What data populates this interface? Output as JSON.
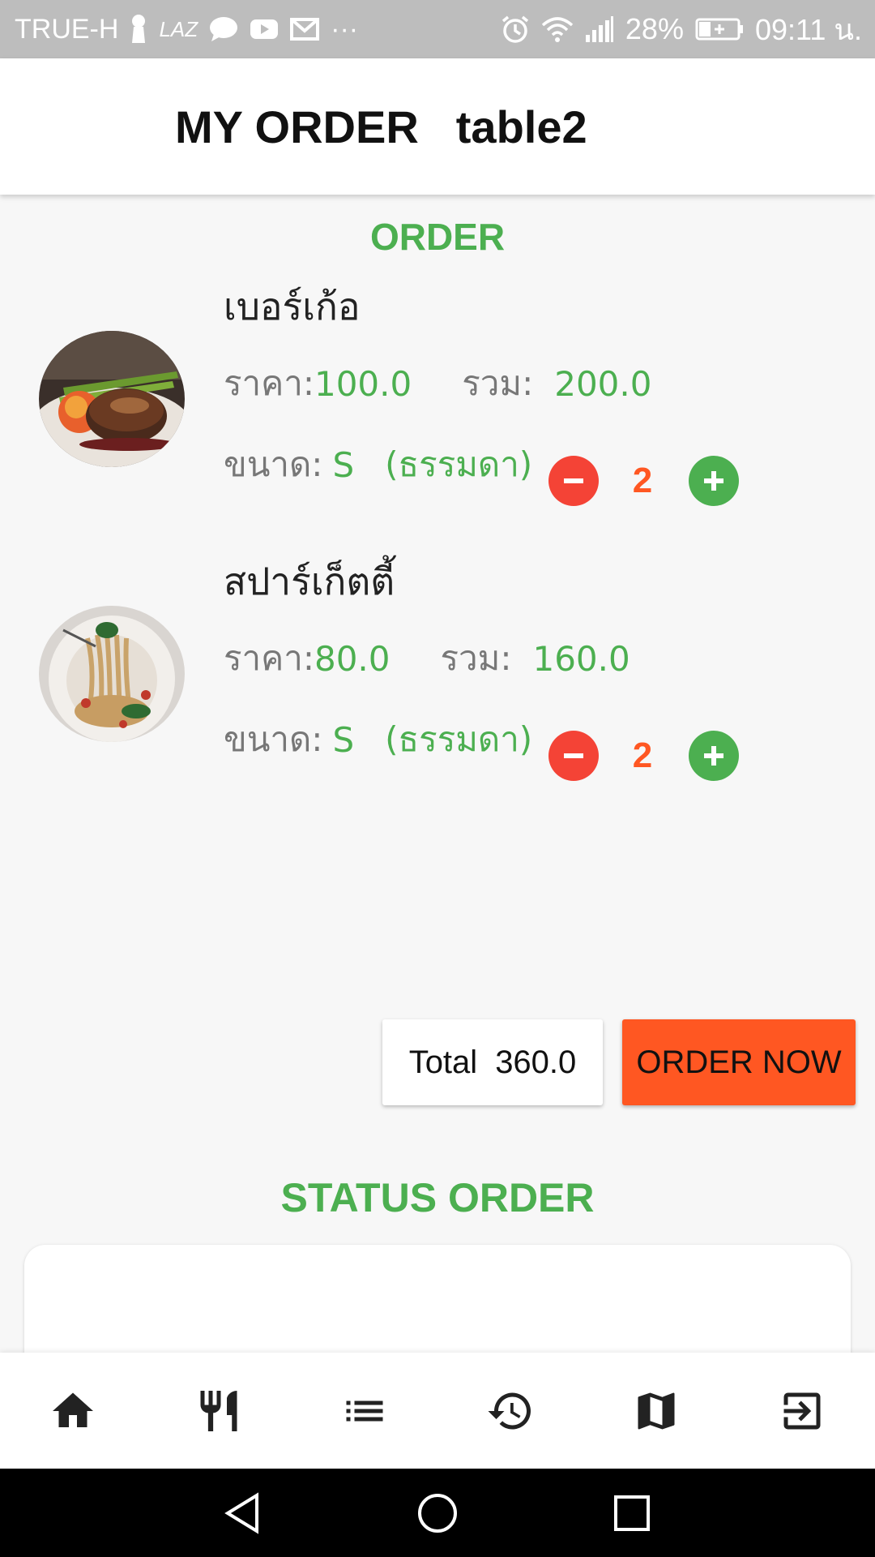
{
  "status_bar": {
    "carrier": "TRUE-H",
    "lazada": "LAZ",
    "more": "···",
    "battery": "28%",
    "time": "09:11 น."
  },
  "header": {
    "title": "MY ORDER",
    "table": "table2"
  },
  "order_section": {
    "title": "ORDER",
    "price_label": "ราคา:",
    "sum_label": "รวม:",
    "size_label": "ขนาด:",
    "items": [
      {
        "name": "เบอร์เก้อ",
        "price": "100.0",
        "total": "200.0",
        "size": "S",
        "size_desc": "(ธรรมดา)",
        "quantity": "2",
        "image_icon": "steak-photo"
      },
      {
        "name": "สปาร์เก็ตตี้",
        "price": "80.0",
        "total": "160.0",
        "size": "S",
        "size_desc": "(ธรรมดา)",
        "quantity": "2",
        "image_icon": "spaghetti-photo"
      }
    ]
  },
  "summary": {
    "total_label": "Total",
    "total_value": "360.0",
    "order_button": "ORDER NOW"
  },
  "status_section": {
    "title": "STATUS ORDER"
  },
  "bottom_nav": {
    "items": [
      "home-icon",
      "restaurant-icon",
      "list-icon",
      "history-icon",
      "map-icon",
      "exit-icon"
    ]
  },
  "colors": {
    "accent_green": "#4caf50",
    "minus_red": "#f44336",
    "order_orange": "#ff5722"
  }
}
